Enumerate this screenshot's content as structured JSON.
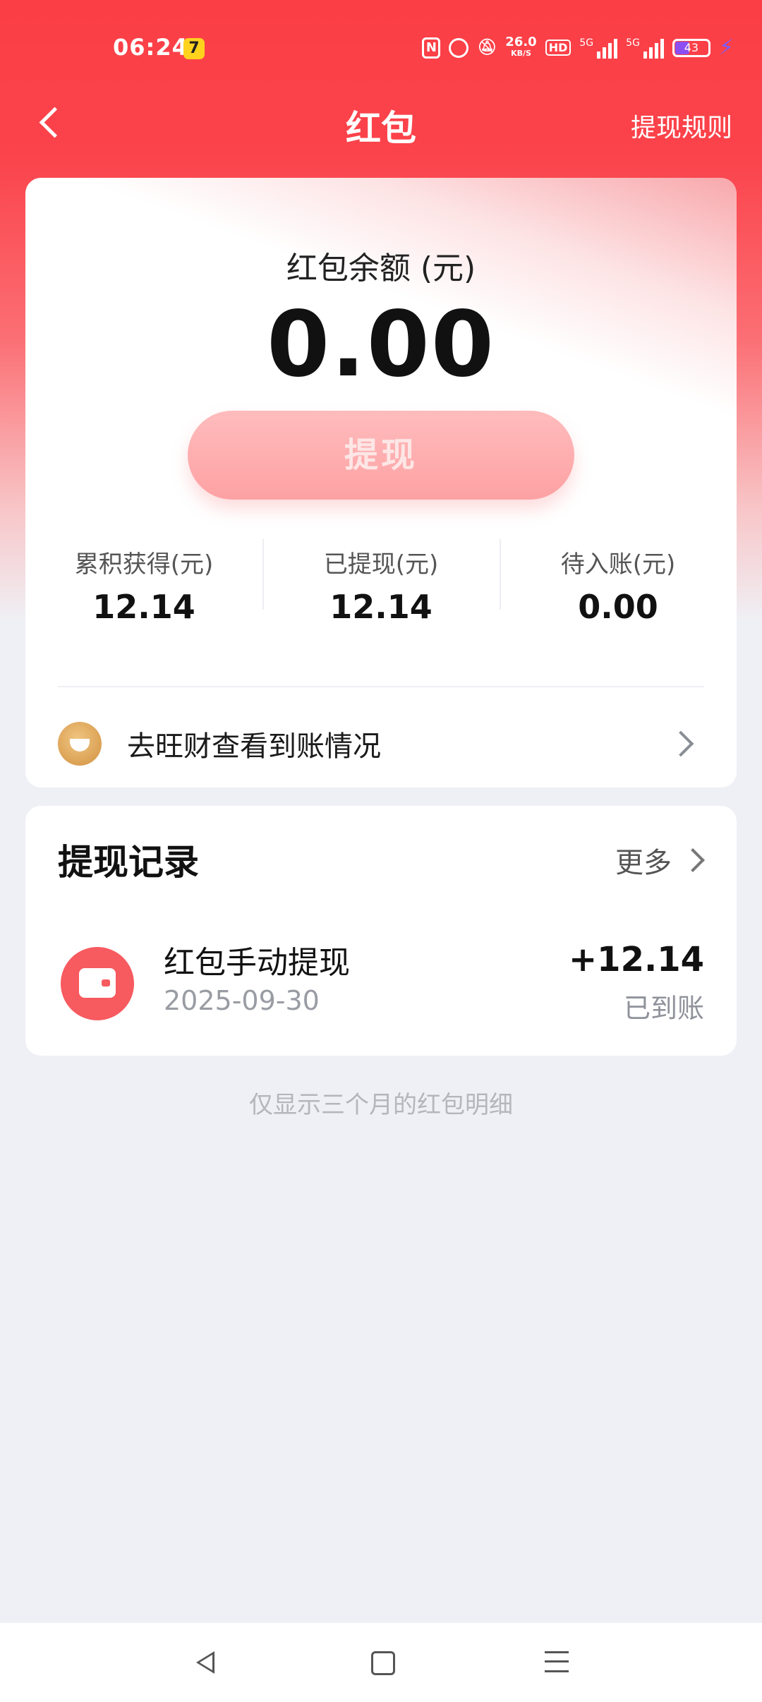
{
  "status_bar": {
    "time": "06:24",
    "app_badge": "7",
    "nfc_label": "N",
    "network_speed_value": "26.0",
    "network_speed_unit": "KB/S",
    "hd_label": "HD",
    "signal1_label": "5G",
    "signal2_label": "5G",
    "battery_level": "43",
    "battery_color": "#8c4ef0",
    "charging_icon": "bolt-icon"
  },
  "header": {
    "title": "红包",
    "back_icon": "chevron-left-icon",
    "rules_label": "提现规则",
    "background_color": "#fb3e46"
  },
  "balance_card": {
    "label": "红包余额 (元)",
    "amount": "0.00",
    "withdraw_label": "提现",
    "stats": [
      {
        "label": "累积获得(元)",
        "value": "12.14"
      },
      {
        "label": "已提现(元)",
        "value": "12.14"
      },
      {
        "label": "待入账(元)",
        "value": "0.00"
      }
    ],
    "wangcai_text": "去旺财查看到账情况",
    "wangcai_icon": "coin-icon"
  },
  "records": {
    "title": "提现记录",
    "more_label": "更多",
    "items": [
      {
        "name": "红包手动提现",
        "date": "2025-09-30",
        "amount": "+12.14",
        "status": "已到账",
        "icon": "wallet-icon"
      }
    ]
  },
  "footnote": "仅显示三个月的红包明细",
  "nav_bar": {
    "back_icon": "triangle-back-icon",
    "home_icon": "square-home-icon",
    "menu_icon": "menu-lines-icon"
  }
}
